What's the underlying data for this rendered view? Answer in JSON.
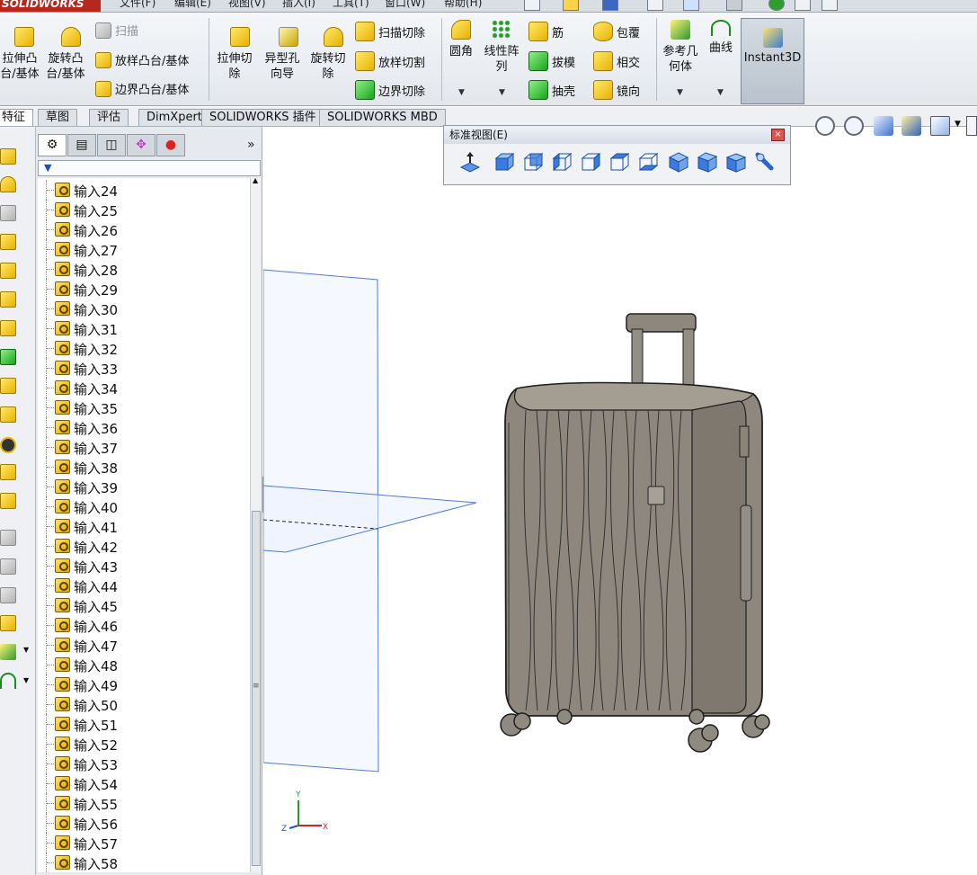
{
  "app": {
    "brand": "SOLIDWORKS",
    "menus": [
      "文件(F)",
      "编辑(E)",
      "视图(V)",
      "插入(I)",
      "工具(T)",
      "窗口(W)",
      "帮助(H)"
    ]
  },
  "commands": {
    "extrude_boss": "拉伸凸台/基体",
    "revolve_boss": "旋转凸台/基体",
    "sweep": "扫描",
    "loft": "放样凸台/基体",
    "boundary": "边界凸台/基体",
    "extrude_cut": "拉伸切除",
    "hole_wizard": "异型孔向导",
    "revolve_cut": "旋转切除",
    "swept_cut": "扫描切除",
    "lofted_cut": "放样切割",
    "boundary_cut": "边界切除",
    "fillet": "圆角",
    "linear_pattern": "线性阵列",
    "rib": "筋",
    "draft": "拔模",
    "shell": "抽壳",
    "wrap": "包覆",
    "intersect": "相交",
    "mirror": "镜向",
    "ref_geometry": "参考几何体",
    "curves": "曲线",
    "instant3d": "Instant3D"
  },
  "tabs": [
    "特征",
    "草图",
    "评估",
    "DimXpert",
    "SOLIDWORKS 插件",
    "SOLIDWORKS MBD"
  ],
  "std_views": {
    "title": "标准视图(E)",
    "close": "×"
  },
  "tree_items": [
    "输入24",
    "输入25",
    "输入26",
    "输入27",
    "输入28",
    "输入29",
    "输入30",
    "输入31",
    "输入32",
    "输入33",
    "输入34",
    "输入35",
    "输入36",
    "输入37",
    "输入38",
    "输入39",
    "输入40",
    "输入41",
    "输入42",
    "输入43",
    "输入44",
    "输入45",
    "输入46",
    "输入47",
    "输入48",
    "输入49",
    "输入50",
    "输入51",
    "输入52",
    "输入53",
    "输入54",
    "输入55",
    "输入56",
    "输入57",
    "输入58"
  ],
  "triad": {
    "x": "X",
    "y": "Y",
    "z": "Z"
  },
  "colors": {
    "brand_red": "#b8261e",
    "plane_blue": "#4f7bd8",
    "luggage_body": "#8d877d"
  }
}
